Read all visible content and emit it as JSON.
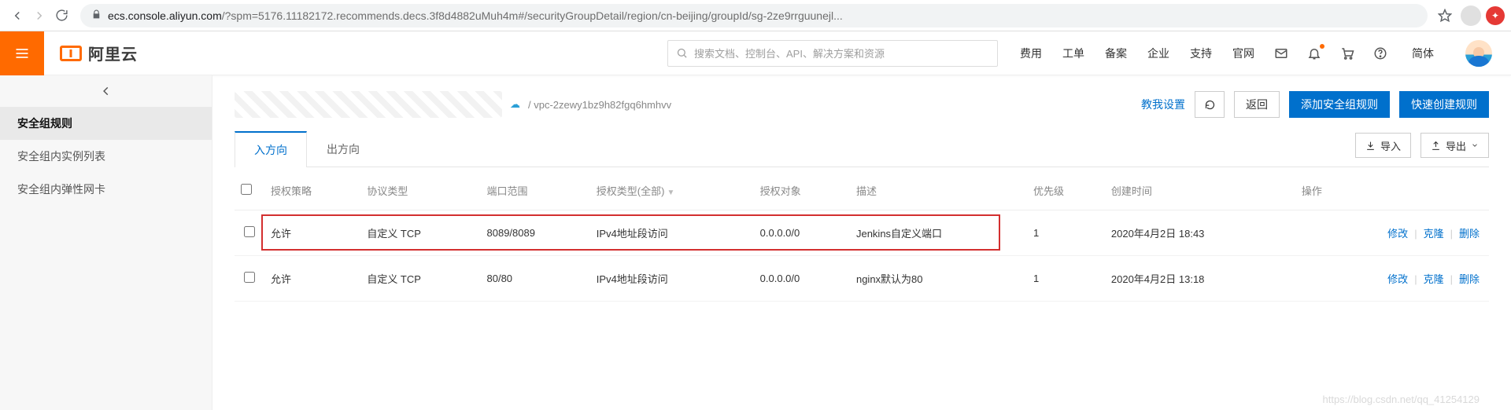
{
  "browser": {
    "url_host": "ecs.console.aliyun.com",
    "url_rest": "/?spm=5176.11182172.recommends.decs.3f8d4882uMuh4m#/securityGroupDetail/region/cn-beijing/groupId/sg-2ze9rrguunejl..."
  },
  "header": {
    "brand": "阿里云",
    "search_placeholder": "搜索文档、控制台、API、解决方案和资源",
    "nav": [
      "费用",
      "工单",
      "备案",
      "企业",
      "支持",
      "官网"
    ],
    "lang": "简体"
  },
  "sidebar": {
    "items": [
      {
        "label": "安全组规则",
        "active": true
      },
      {
        "label": "安全组内实例列表",
        "active": false
      },
      {
        "label": "安全组内弹性网卡",
        "active": false
      }
    ]
  },
  "page": {
    "vpc": "vpc-2zewy1bz9h82fgq6hmhvv",
    "teach": "教我设置",
    "back": "返回",
    "add_rule": "添加安全组规则",
    "quick_create": "快速创建规则"
  },
  "tabs": {
    "list": [
      {
        "label": "入方向",
        "active": true
      },
      {
        "label": "出方向",
        "active": false
      }
    ],
    "import": "导入",
    "export": "导出"
  },
  "table": {
    "headers": {
      "policy": "授权策略",
      "protocol": "协议类型",
      "port": "端口范围",
      "auth_type": "授权类型(全部)",
      "auth_obj": "授权对象",
      "desc": "描述",
      "priority": "优先级",
      "created": "创建时间",
      "ops": "操作"
    },
    "rows": [
      {
        "policy": "允许",
        "protocol": "自定义 TCP",
        "port": "8089/8089",
        "auth_type": "IPv4地址段访问",
        "auth_obj": "0.0.0.0/0",
        "desc": "Jenkins自定义端口",
        "priority": "1",
        "created": "2020年4月2日 18:43",
        "highlight": true
      },
      {
        "policy": "允许",
        "protocol": "自定义 TCP",
        "port": "80/80",
        "auth_type": "IPv4地址段访问",
        "auth_obj": "0.0.0.0/0",
        "desc": "nginx默认为80",
        "priority": "1",
        "created": "2020年4月2日 13:18",
        "highlight": false
      }
    ],
    "ops": {
      "edit": "修改",
      "clone": "克隆",
      "delete": "删除"
    }
  },
  "watermark": "https://blog.csdn.net/qq_41254129"
}
